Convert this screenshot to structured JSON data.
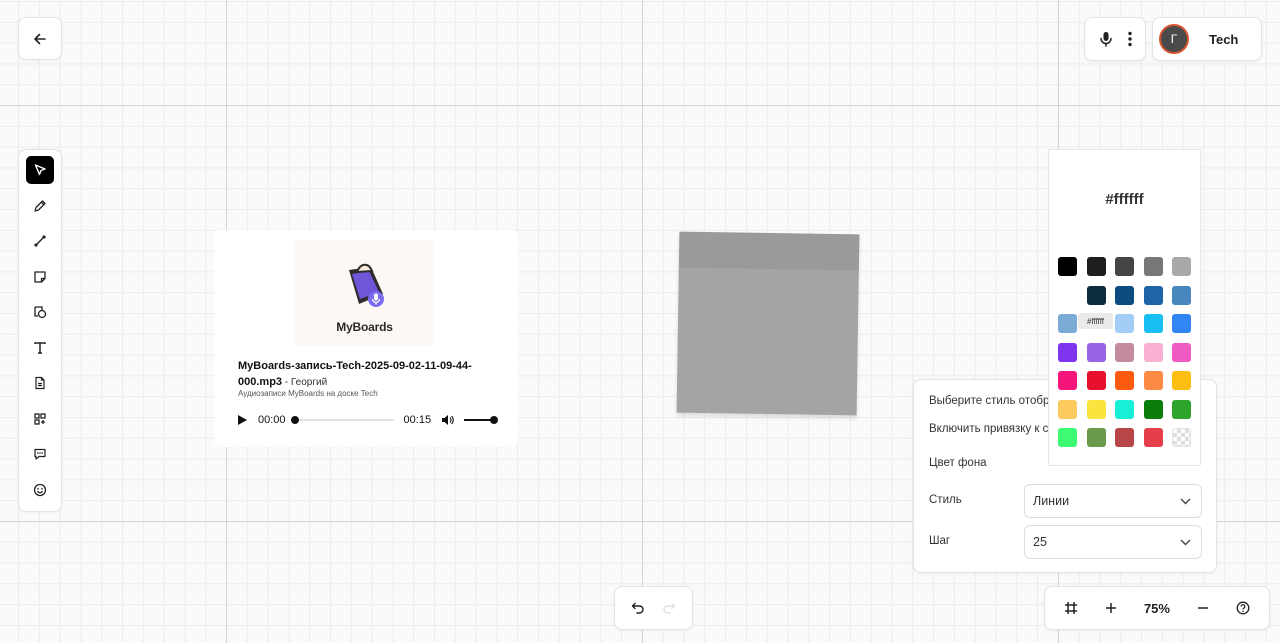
{
  "header": {
    "back_icon": "arrow-left-icon",
    "tools": [
      {
        "name": "mic-icon"
      },
      {
        "name": "more-vertical-icon"
      }
    ],
    "user_initial": "Г",
    "board_name": "Tech"
  },
  "toolbar": {
    "items": [
      {
        "name": "select-tool",
        "icon": "cursor-icon",
        "active": true
      },
      {
        "name": "pen-tool",
        "icon": "pen-icon",
        "active": false
      },
      {
        "name": "line-tool",
        "icon": "line-icon",
        "active": false
      },
      {
        "name": "sticky-tool",
        "icon": "sticky-note-icon",
        "active": false
      },
      {
        "name": "shapes-tool",
        "icon": "shapes-icon",
        "active": false
      },
      {
        "name": "text-tool",
        "icon": "text-icon",
        "active": false
      },
      {
        "name": "file-tool",
        "icon": "file-icon",
        "active": false
      },
      {
        "name": "apps-tool",
        "icon": "grid-plus-icon",
        "active": false
      },
      {
        "name": "comment-tool",
        "icon": "comment-icon",
        "active": false
      },
      {
        "name": "emoji-tool",
        "icon": "emoji-icon",
        "active": false
      }
    ]
  },
  "audio": {
    "cover_brand": "MyBoards",
    "title": "MyBoards-запись-Tech-2025-09-02-11-09-44-000.mp3",
    "author": " - Георгий",
    "subtitle": "Аудиозаписи MyBoards на доске Tech",
    "current_time": "00:00",
    "duration": "00:15",
    "progress": 0,
    "volume": 1
  },
  "sticky": {
    "color": "#a4a4a4"
  },
  "settings": {
    "display_style_label": "Выберите стиль отобра",
    "snap_label": "Включить привязку к с",
    "bg_color_label": "Цвет фона",
    "style_label": "Стиль",
    "style_value": "Линии",
    "step_label": "Шаг",
    "step_value": "25"
  },
  "color_picker": {
    "current": "#ffffff",
    "tooltip": "#ffffff",
    "swatches": [
      [
        "#000000",
        "#1e1e1e",
        "#454545",
        "#777777",
        "#a9a9a9"
      ],
      [
        "#ffffff",
        "#0d2c3c",
        "#0d4c80",
        "#1f63a8",
        "#4a86be"
      ],
      [
        "#7aaad6",
        "#ffffff",
        "#a3cdf6",
        "#19bff2",
        "#3186f4"
      ],
      [
        "#7f34f0",
        "#9a64e6",
        "#c28ba0",
        "#f8b1d0",
        "#f05bc3"
      ],
      [
        "#f5157a",
        "#e8112d",
        "#fe5b10",
        "#fd8b45",
        "#fdbe12"
      ],
      [
        "#fccb60",
        "#fce43e",
        "#19eed6",
        "#0a7d0a",
        "#2da52d"
      ],
      [
        "#3dfa73",
        "#6a9a4a",
        "#b94646",
        "#e63e4a",
        "transparent"
      ]
    ]
  },
  "undo": {
    "undo_icon": "undo-icon",
    "redo_icon": "redo-icon"
  },
  "zoom": {
    "level": "75%"
  }
}
